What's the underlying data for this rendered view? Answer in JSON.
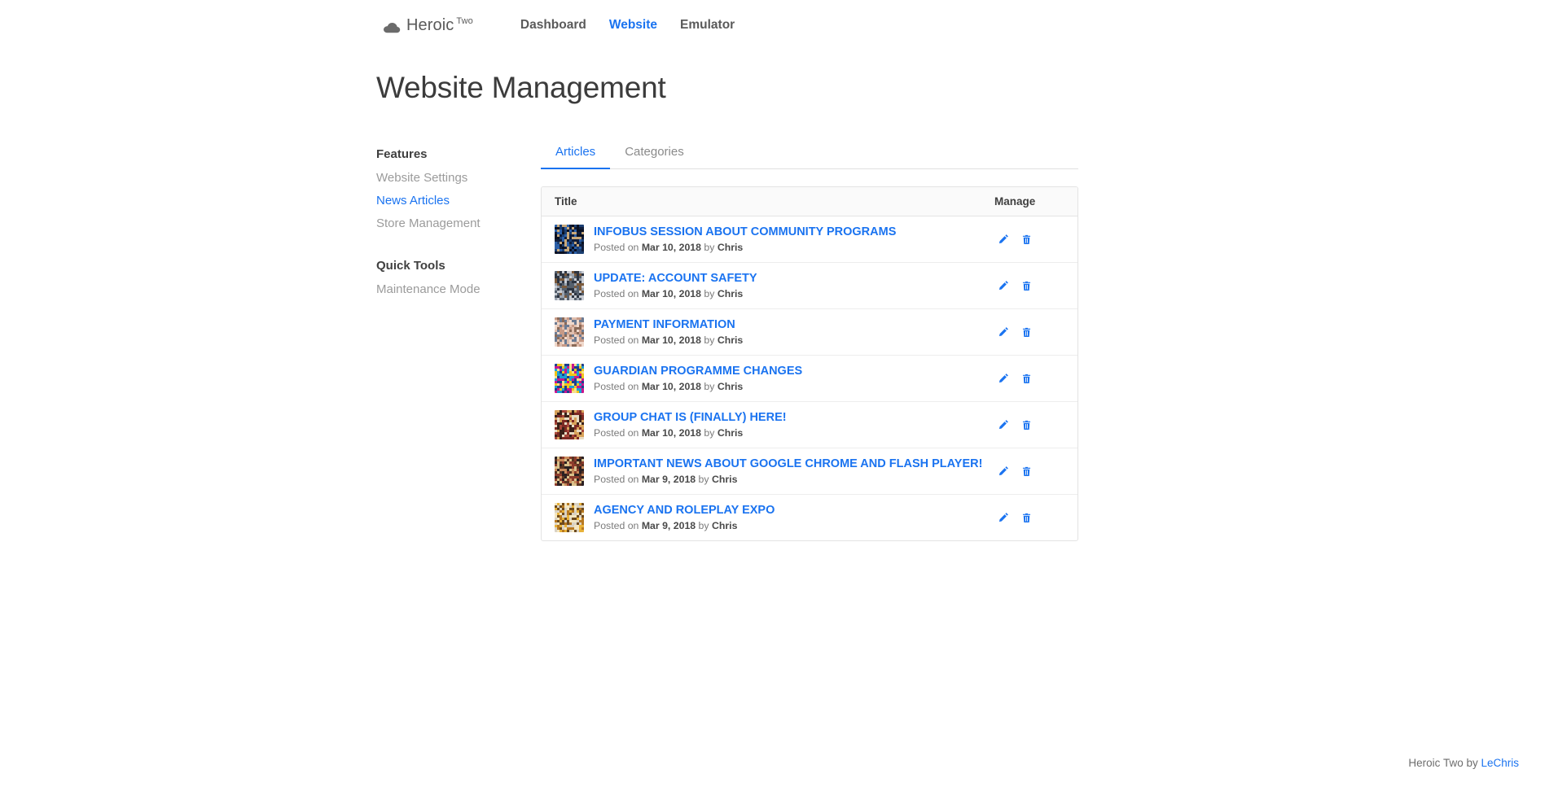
{
  "navbar": {
    "brand": {
      "name": "Heroic",
      "superscript": "Two",
      "icon": "cloud-icon"
    },
    "links": [
      {
        "label": "Dashboard",
        "active": false
      },
      {
        "label": "Website",
        "active": true
      },
      {
        "label": "Emulator",
        "active": false
      }
    ]
  },
  "page": {
    "title": "Website Management"
  },
  "sidebar": {
    "sections": [
      {
        "heading": "Features",
        "items": [
          {
            "label": "Website Settings",
            "active": false
          },
          {
            "label": "News Articles",
            "active": true
          },
          {
            "label": "Store Management",
            "active": false
          }
        ]
      },
      {
        "heading": "Quick Tools",
        "items": [
          {
            "label": "Maintenance Mode",
            "active": false
          }
        ]
      }
    ]
  },
  "tabs": [
    {
      "label": "Articles",
      "active": true
    },
    {
      "label": "Categories",
      "active": false
    }
  ],
  "table": {
    "columns": {
      "title": "Title",
      "manage": "Manage"
    },
    "meta_prefix": "Posted on",
    "meta_by": "by",
    "rows": [
      {
        "title": "INFOBUS SESSION ABOUT COMMUNITY PROGRAMS",
        "date": "Mar 10, 2018",
        "author": "Chris",
        "thumb": "infobus-thumbnail"
      },
      {
        "title": "UPDATE: ACCOUNT SAFETY",
        "date": "Mar 10, 2018",
        "author": "Chris",
        "thumb": "account-safety-thumbnail"
      },
      {
        "title": "PAYMENT INFORMATION",
        "date": "Mar 10, 2018",
        "author": "Chris",
        "thumb": "payment-thumbnail"
      },
      {
        "title": "GUARDIAN PROGRAMME CHANGES",
        "date": "Mar 10, 2018",
        "author": "Chris",
        "thumb": "guardian-shield-thumbnail"
      },
      {
        "title": "GROUP CHAT IS (FINALLY) HERE!",
        "date": "Mar 10, 2018",
        "author": "Chris",
        "thumb": "group-chat-thumbnail"
      },
      {
        "title": "IMPORTANT NEWS ABOUT GOOGLE CHROME AND FLASH PLAYER!",
        "date": "Mar 9, 2018",
        "author": "Chris",
        "thumb": "chrome-flash-thumbnail"
      },
      {
        "title": "AGENCY AND ROLEPLAY EXPO",
        "date": "Mar 9, 2018",
        "author": "Chris",
        "thumb": "agency-expo-thumbnail"
      }
    ],
    "actions": {
      "edit": "edit-pencil-icon",
      "delete": "trash-icon"
    }
  },
  "footer": {
    "text": "Heroic Two by ",
    "link": "LeChris"
  },
  "colors": {
    "accent": "#1a73f0",
    "muted": "#9b9b9b",
    "text": "#3c3c3c",
    "border": "#e3e3e3",
    "header_bg": "#fafafa"
  }
}
